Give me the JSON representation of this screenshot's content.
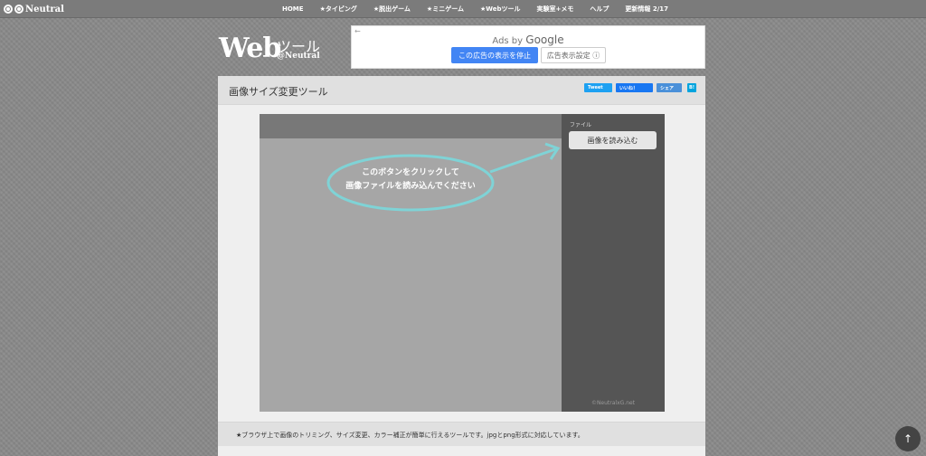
{
  "topbar": {
    "logo_text": "Neutral",
    "nav": [
      "HOME",
      "★タイピング",
      "★脱出ゲーム",
      "★ミニゲーム",
      "★Webツール",
      "実験室+メモ",
      "ヘルプ",
      "更新情報 2/17"
    ]
  },
  "header": {
    "title_main": "Web",
    "title_sub": "ツール",
    "title_at": "@Neutral"
  },
  "ad": {
    "back": "←",
    "ads_by": "Ads by",
    "google": "Google",
    "stop_button": "この広告の表示を停止",
    "settings_button": "広告表示設定 ⓘ"
  },
  "main": {
    "page_title": "画像サイズ変更ツール",
    "shares": {
      "tweet": "Tweet",
      "like": "いいね！",
      "share": "シェア",
      "hatena": "B!"
    },
    "tool": {
      "file_label": "ファイル",
      "load_button": "画像を読み込む",
      "hint_line1": "このボタンをクリックして",
      "hint_line2": "画像ファイルを読み込んでください",
      "copyright": "©NeutralxG.net"
    },
    "description": "★ブラウザ上で画像のトリミング、サイズ変更、カラー補正が簡単に行えるツールです。jpgとpng形式に対応しています。"
  },
  "scroll_top": "↑",
  "colors": {
    "accent": "#4285f4",
    "hint_line": "#7fd3d6"
  }
}
